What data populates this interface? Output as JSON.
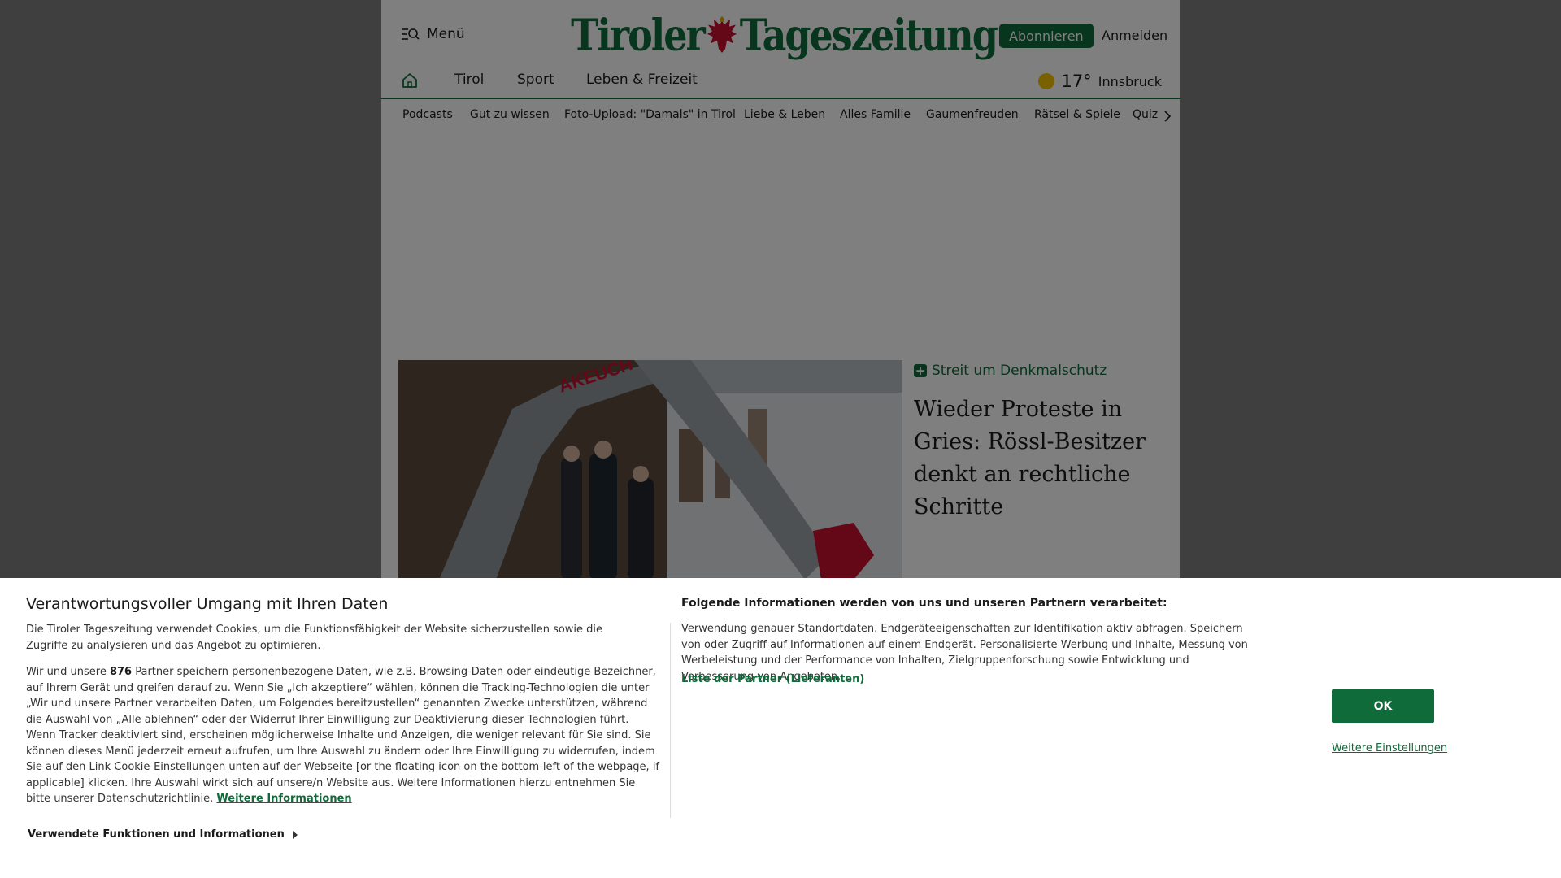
{
  "header": {
    "menu_label": "Menü",
    "logo_left": "Tiroler",
    "logo_right": "Tageszeitung",
    "subscribe_label": "Abonnieren",
    "login_label": "Anmelden"
  },
  "mainnav": {
    "items": [
      "Tirol",
      "Sport",
      "Leben & Freizeit"
    ],
    "weather": {
      "temperature": "17°",
      "city": "Innsbruck",
      "icon": "sun-icon"
    }
  },
  "subnav": {
    "items": [
      "Podcasts",
      "Gut zu wissen",
      "Foto-Upload: \"Damals\" in Tirol",
      "Liebe & Leben",
      "Alles Familie",
      "Gaumenfreuden",
      "Rätsel & Spiele",
      "Quiz"
    ]
  },
  "hero": {
    "kicker": "Streit um Denkmalschutz",
    "title": "Wieder Proteste in Gries: Rössl-Besitzer denkt an rechtliche Schritte",
    "image_text": "AKEUCH"
  },
  "consent": {
    "title": "Verantwortungsvoller Umgang mit Ihren Daten",
    "intro": "Die Tiroler Tageszeitung verwendet Cookies, um die Funktionsfähigkeit der Website sicherzustellen sowie die Zugriffe zu analysieren und das Angebot zu optimieren.",
    "body_prefix": "Wir und unsere ",
    "partner_count": "876",
    "body_main": " Partner speichern personenbezogene Daten, wie z.B. Browsing-Daten oder eindeutige Bezeichner, auf Ihrem Gerät und greifen darauf zu. Wenn Sie „Ich akzeptiere“ wählen, können die Tracking-Technologien die unter „Wir und unsere Partner verarbeiten Daten, um Folgendes bereitzustellen“ genannten Zwecke unterstützen, während die Auswahl von „Alle ablehnen“ oder der Widerruf Ihrer Einwilligung zur Deaktivierung dieser Technologien führt. Wenn Tracker deaktiviert sind, erscheinen möglicherweise Inhalte und Anzeigen, die weniger relevant für Sie sind. Sie können dieses Menü jederzeit erneut aufrufen, um Ihre Auswahl zu ändern oder Ihre Einwilligung zu widerrufen, indem Sie auf den Link Cookie-Einstellungen unten auf der Webseite [or the floating icon on the bottom-left of the webpage, if applicable] klicken. Ihre Auswahl wirkt sich auf unsere/n Website aus. Weitere Informationen hierzu entnehmen Sie bitte unserer Datenschutzrichtlinie. ",
    "more_info_link": "Weitere Informationen",
    "functions_label": "Verwendete Funktionen und Informationen",
    "right_title": "Folgende Informationen werden von uns und unseren Partnern verarbeitet:",
    "right_text": "Verwendung genauer Standortdaten. Endgeräteeigenschaften zur Identifikation aktiv abfragen. Speichern von oder Zugriff auf Informationen auf einem Endgerät. Personalisierte Werbung und Inhalte, Messung von Werbeleistung und der Performance von Inhalten, Zielgruppenforschung sowie Entwicklung und Verbesserung von Angeboten.",
    "partners_link": "Liste der Partner (Lieferanten)",
    "ok_label": "OK",
    "settings_link": "Weitere Einstellungen"
  },
  "colors": {
    "brand": "#0f6b3a",
    "overlay": "rgba(0,0,0,0.5)"
  }
}
